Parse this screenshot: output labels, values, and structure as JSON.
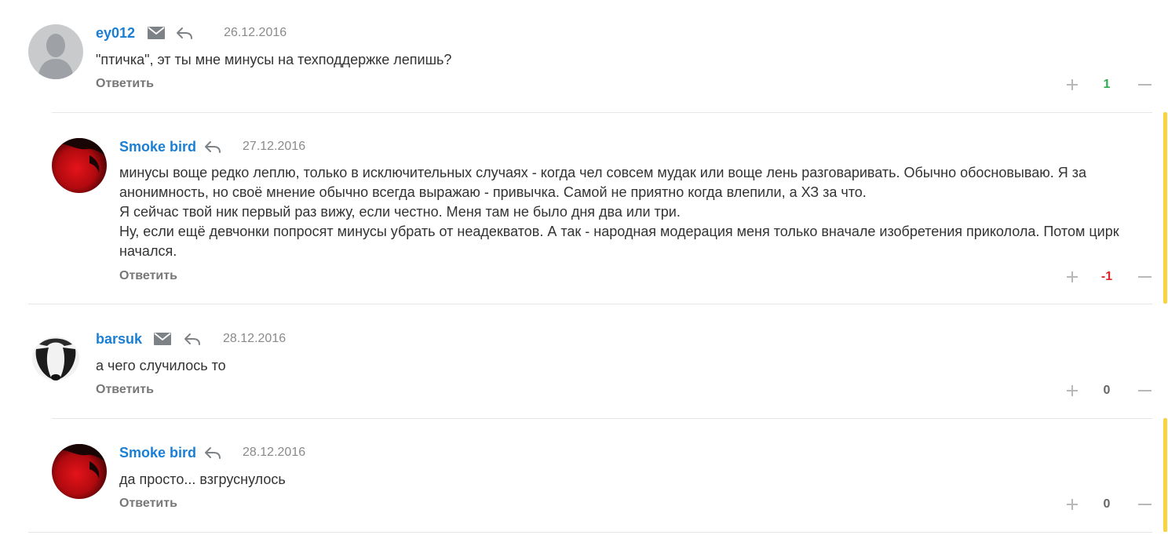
{
  "comments": [
    {
      "author": "ey012",
      "date": "26.12.2016",
      "text": [
        "\"птичка\", эт ты мне минусы на техподдержке лепишь?"
      ],
      "reply_label": "Ответить",
      "score": "1",
      "avatar": "default-user-avatar",
      "has_mail": true,
      "score_color": "#2eab4f"
    },
    {
      "author": "Smoke bird",
      "date": "27.12.2016",
      "text": [
        "минусы воще редко леплю, только в исключительных случаях - когда чел совсем мудак или воще лень разговаривать. Обычно обосновываю. Я за анонимность, но своё мнение обычно всегда выражаю - привычка. Самой не приятно когда влепили, а ХЗ за что.",
        "Я сейчас твой ник первый раз вижу, если честно. Меня там не было дня два или три.",
        "Ну, если ещё девчонки попросят минусы убрать от неадекватов. А так - народная модерация меня только вначале изобретения приколола. Потом цирк начался."
      ],
      "reply_label": "Ответить",
      "score": "-1",
      "avatar": "red-bird-avatar",
      "has_mail": false,
      "score_color": "#e0262a"
    },
    {
      "author": "barsuk",
      "date": "28.12.2016",
      "text": [
        "а чего случилось то"
      ],
      "reply_label": "Ответить",
      "score": "0",
      "avatar": "badger-avatar",
      "has_mail": true,
      "score_color": "#666666"
    },
    {
      "author": "Smoke bird",
      "date": "28.12.2016",
      "text": [
        "да просто... взгруснулось"
      ],
      "reply_label": "Ответить",
      "score": "0",
      "avatar": "red-bird-avatar",
      "has_mail": false,
      "score_color": "#666666"
    }
  ],
  "icons": {
    "mail": "mail-icon",
    "reply": "reply-arrow-icon",
    "vote_up": "plus-icon",
    "vote_down": "minus-icon"
  },
  "colors": {
    "author": "#1a7fd4",
    "new_reply_marker": "#f7d33e"
  }
}
